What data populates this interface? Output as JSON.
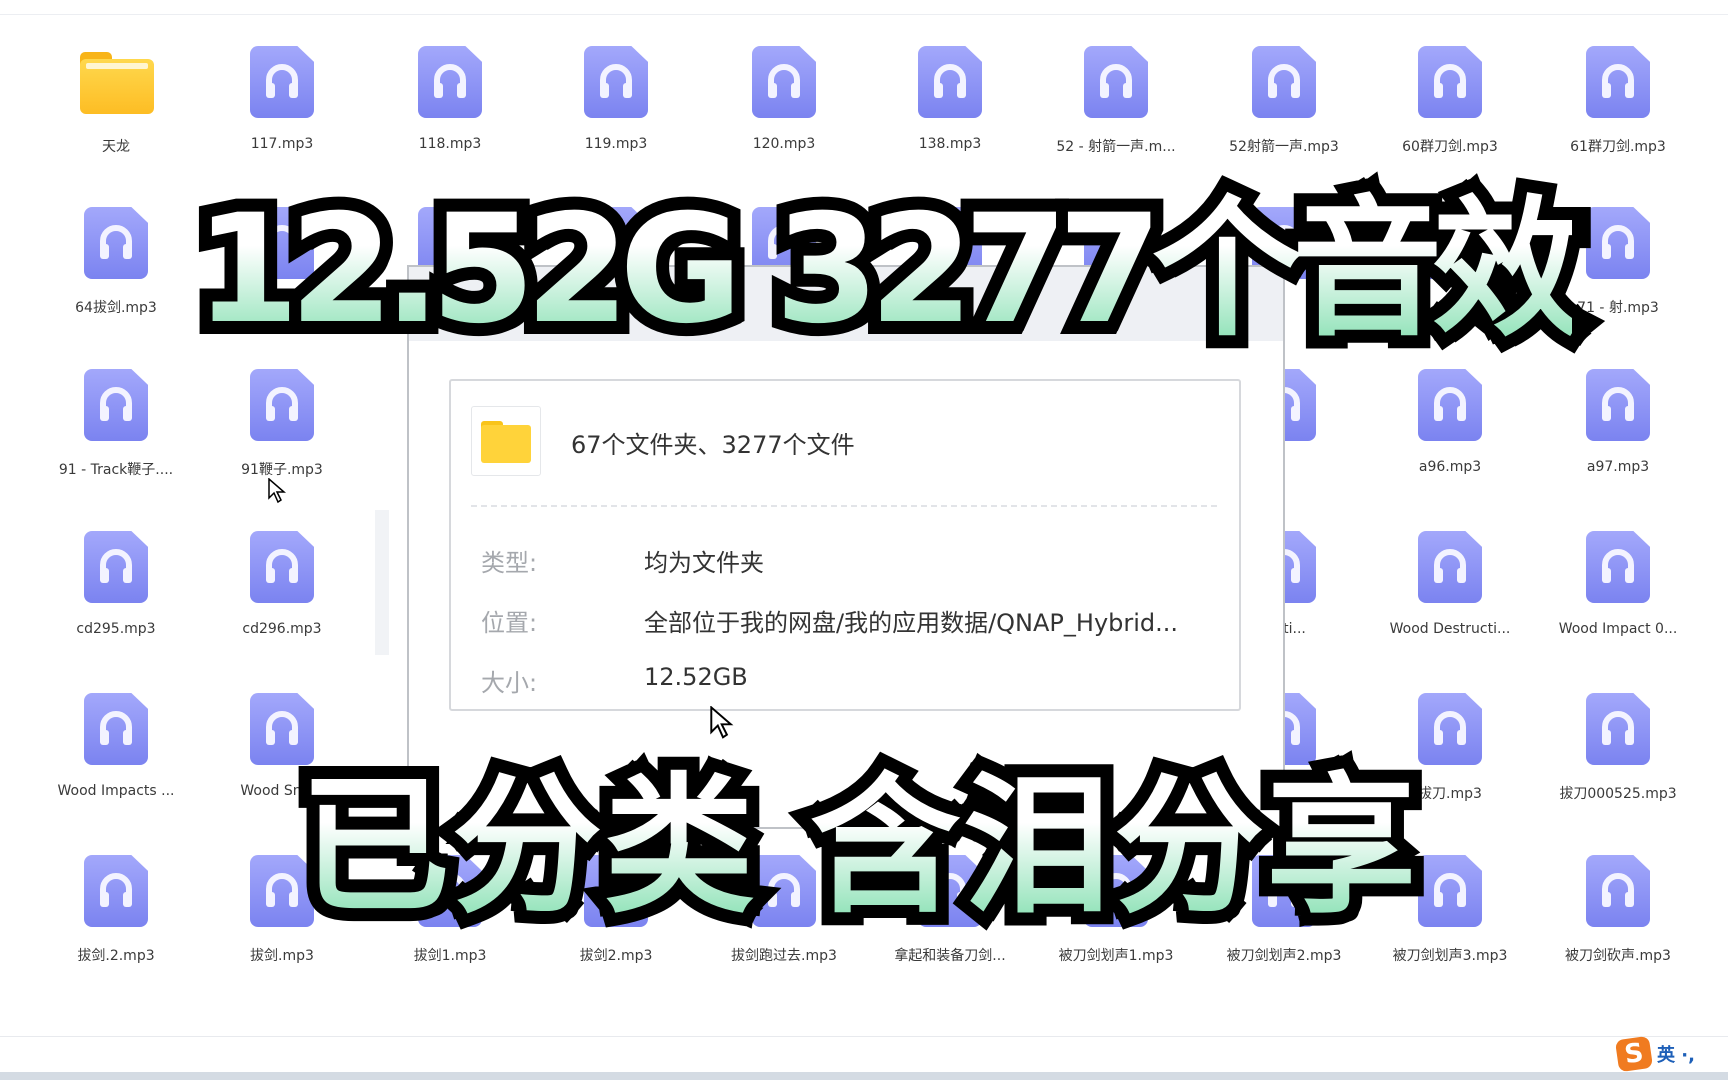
{
  "grid": {
    "rows": [
      [
        "天龙",
        "117.mp3",
        "118.mp3",
        "119.mp3",
        "120.mp3",
        "138.mp3",
        "52 - 射箭一声.m...",
        "52射箭一声.mp3",
        "60群刀剑.mp3",
        "61群刀剑.mp3"
      ],
      [
        "64拔剑.mp3",
        "",
        "",
        "",
        "",
        "",
        "",
        "",
        "...p3",
        "71 - 射.mp3"
      ],
      [
        "91 - Track鞭子....",
        "91鞭子.mp3",
        "",
        "",
        "",
        "",
        "",
        "",
        "a96.mp3",
        "a97.mp3"
      ],
      [
        "cd295.mp3",
        "cd296.mp3",
        "",
        "",
        "",
        "",
        "",
        "...cti...",
        "Wood Destructi...",
        "Wood Impact 0..."
      ],
      [
        "Wood Impacts ...",
        "Wood Sna...",
        "",
        "",
        "",
        "",
        "",
        "",
        "拔刀.mp3",
        "拔刀000525.mp3"
      ],
      [
        "拔剑.2.mp3",
        "拔剑.mp3",
        "拔剑1.mp3",
        "拔剑2.mp3",
        "拔剑跑过去.mp3",
        "拿起和装备刀剑...",
        "被刀剑划声1.mp3",
        "被刀剑划声2.mp3",
        "被刀剑划声3.mp3",
        "被刀剑砍声.mp3"
      ]
    ],
    "folder_item": "天龙"
  },
  "dialog": {
    "summary": "67个文件夹、3277个文件",
    "type_label": "类型:",
    "type_value": "均为文件夹",
    "location_label": "位置:",
    "location_value": "全部位于我的网盘/我的应用数据/QNAP_Hybrid...",
    "size_label": "大小:",
    "size_value": "12.52GB"
  },
  "overlay": {
    "line1": "12.52G   3277个音效",
    "line2": "已分类 含泪分享"
  },
  "ime": {
    "logo": "S",
    "mode": "英 ·,"
  },
  "colors": {
    "audio_icon": "#8a90f5",
    "folder": "#fdc52e",
    "overlay_gradient_bottom": "#74dba6"
  }
}
